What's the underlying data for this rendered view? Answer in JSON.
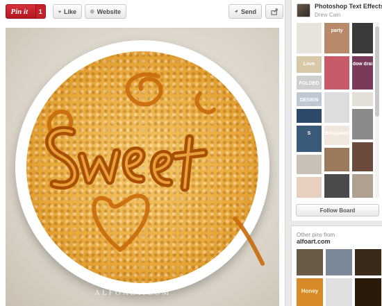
{
  "toolbar": {
    "pin_label": "Pin it",
    "pin_count": "1",
    "like_label": "Like",
    "website_label": "Website",
    "send_label": "Send"
  },
  "pin": {
    "watermark": "ALFOART.COM"
  },
  "board": {
    "title": "Photoshop Text Effects",
    "owner": "Drew Cain",
    "follow_label": "Follow Board",
    "thumb_texts": [
      "party",
      "Love",
      "FOLDED",
      "DESIGN",
      "S",
      "dow drai",
      "Bodypaint"
    ]
  },
  "other_pins": {
    "label": "Other pins from",
    "source": "alfoart.com",
    "thumb_texts": [
      "Honey"
    ]
  }
}
